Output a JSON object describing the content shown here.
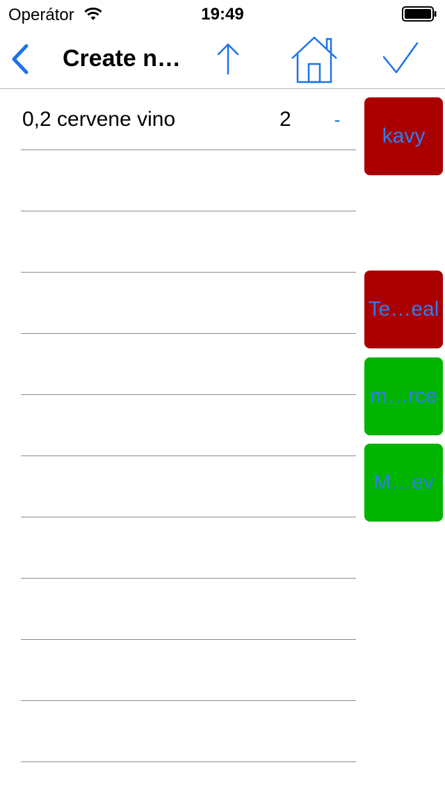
{
  "status_bar": {
    "carrier": "Operátor",
    "time": "19:49",
    "wifi_icon": "wifi-icon",
    "battery_icon": "battery-full-icon"
  },
  "nav": {
    "title": "Create n…",
    "back_icon": "chevron-left-icon",
    "up_icon": "arrow-up-icon",
    "home_icon": "home-icon",
    "confirm_icon": "checkmark-icon",
    "accent_color": "#1a73e8"
  },
  "list": {
    "items": [
      {
        "name": "0,2 cervene vino",
        "quantity": "2",
        "remove_label": "-"
      },
      {
        "name": "",
        "quantity": "",
        "remove_label": ""
      },
      {
        "name": "",
        "quantity": "",
        "remove_label": ""
      },
      {
        "name": "",
        "quantity": "",
        "remove_label": ""
      },
      {
        "name": "",
        "quantity": "",
        "remove_label": ""
      },
      {
        "name": "",
        "quantity": "",
        "remove_label": ""
      },
      {
        "name": "",
        "quantity": "",
        "remove_label": ""
      },
      {
        "name": "",
        "quantity": "",
        "remove_label": ""
      },
      {
        "name": "",
        "quantity": "",
        "remove_label": ""
      },
      {
        "name": "",
        "quantity": "",
        "remove_label": ""
      },
      {
        "name": "",
        "quantity": "",
        "remove_label": ""
      }
    ]
  },
  "categories": {
    "tiles": [
      {
        "label": "kavy",
        "color": "#aa0000"
      },
      {
        "label": "Te…eal",
        "color": "#aa0000"
      },
      {
        "label": "m…rce",
        "color": "#00b400"
      },
      {
        "label": "M…ev",
        "color": "#00b400"
      }
    ],
    "label_color": "#2f7df0"
  }
}
